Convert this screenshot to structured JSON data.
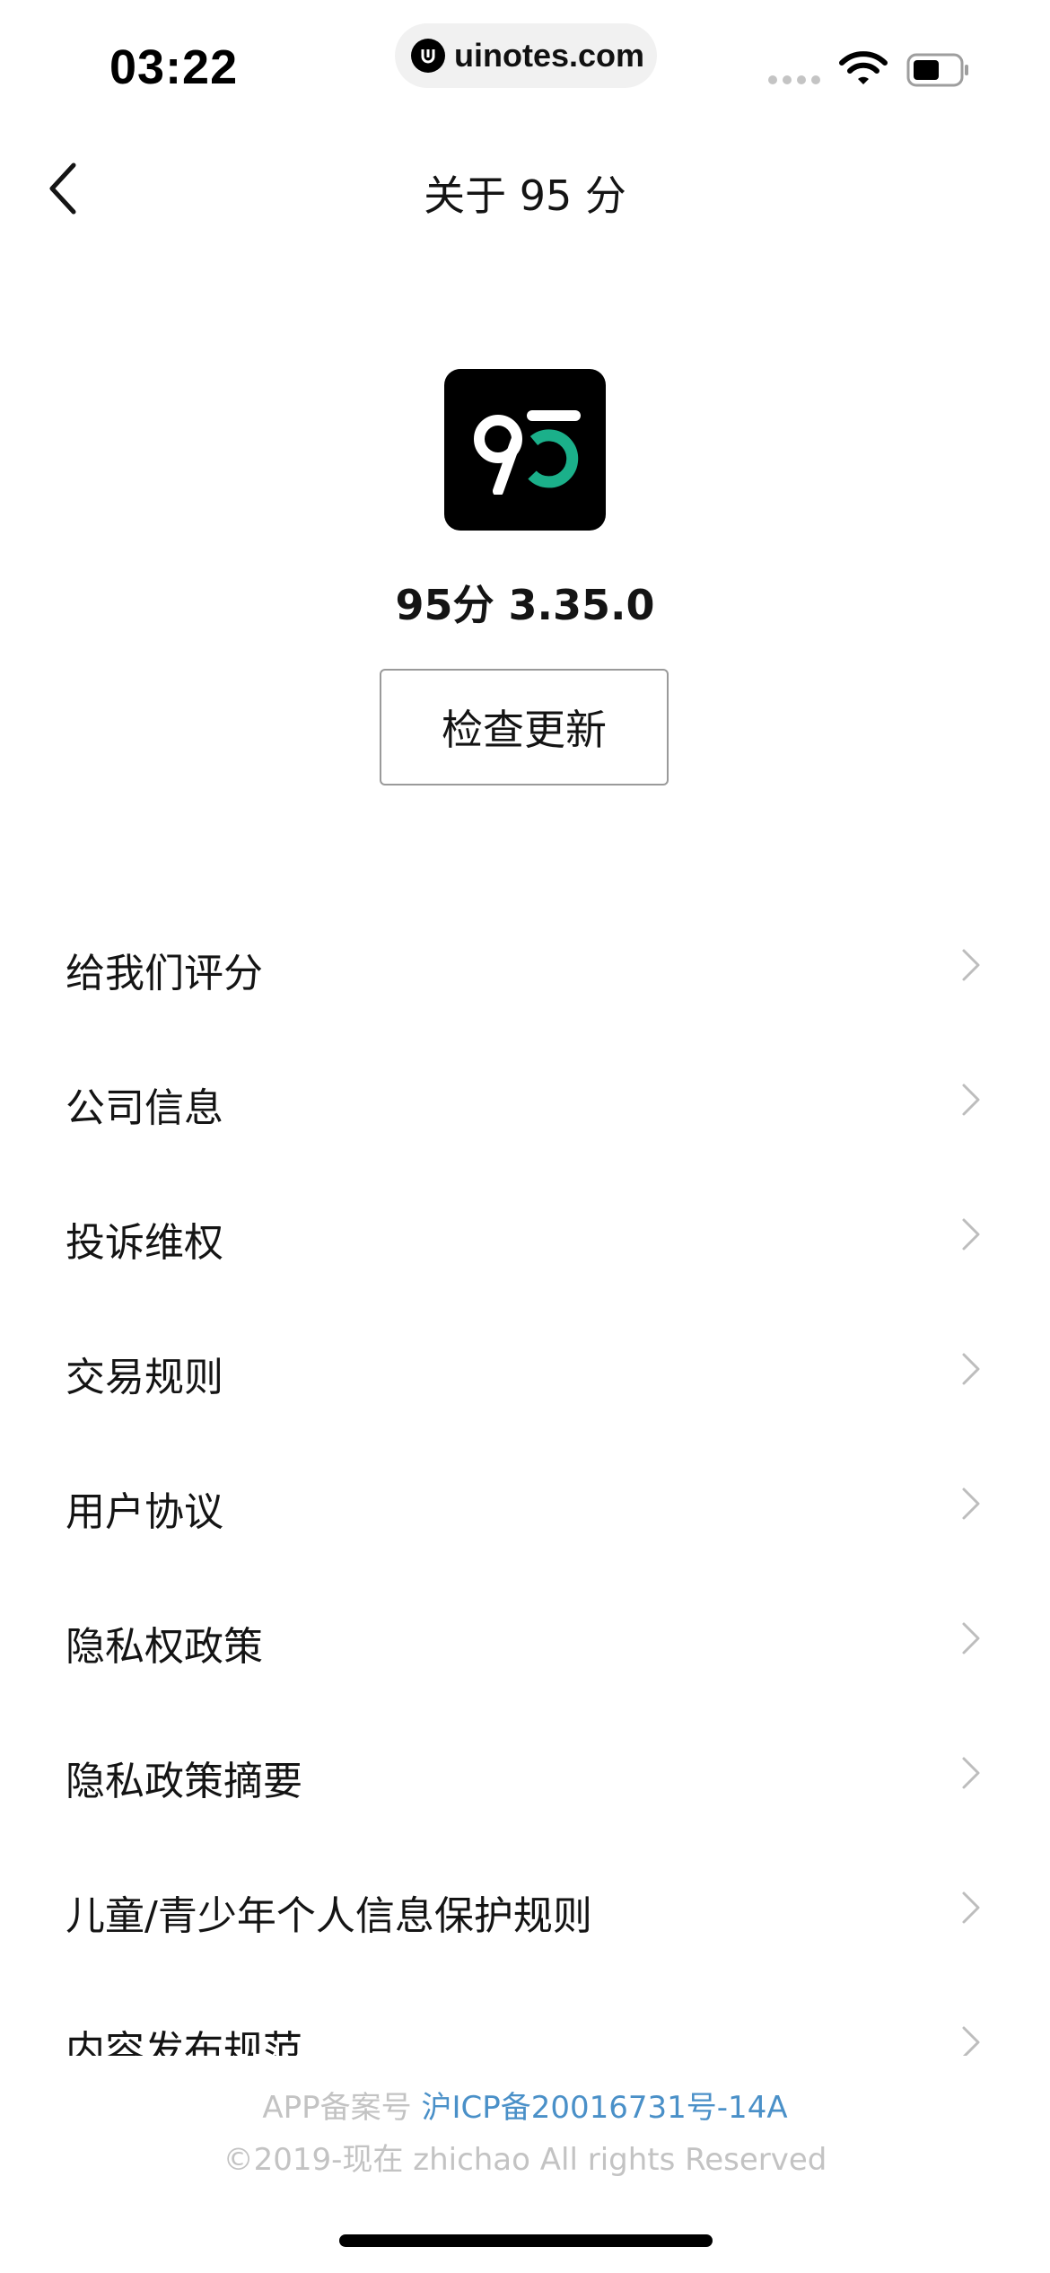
{
  "status_bar": {
    "time": "03:22",
    "url": "uinotes.com"
  },
  "nav": {
    "title": "关于 95 分"
  },
  "app": {
    "version_text": "95分 3.35.0",
    "check_update_label": "检查更新",
    "logo_colors": {
      "background": "#000000",
      "nine": "#ffffff",
      "five": "#1bb08a"
    }
  },
  "menu": {
    "items": [
      {
        "label": "给我们评分"
      },
      {
        "label": "公司信息"
      },
      {
        "label": "投诉维权"
      },
      {
        "label": "交易规则"
      },
      {
        "label": "用户协议"
      },
      {
        "label": "隐私权政策"
      },
      {
        "label": "隐私政策摘要"
      },
      {
        "label": "儿童/青少年个人信息保护规则"
      },
      {
        "label": "内容发布规范"
      }
    ]
  },
  "footer": {
    "icp_prefix": "APP备案号 ",
    "icp_link": "沪ICP备20016731号-14A",
    "copyright": "©2019-现在 zhichao All rights Reserved"
  }
}
